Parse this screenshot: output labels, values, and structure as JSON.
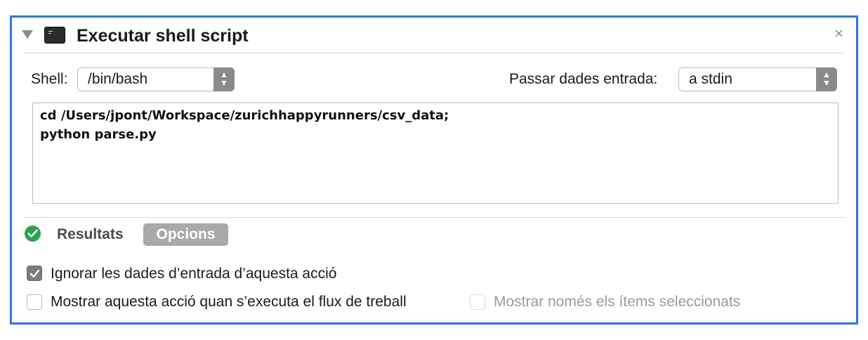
{
  "header": {
    "title": "Executar shell script",
    "close_glyph": "×",
    "icons": [
      "disclosure-triangle-icon",
      "terminal-icon",
      "close-icon"
    ]
  },
  "shell": {
    "label": "Shell:",
    "value": "/bin/bash"
  },
  "input_mode": {
    "label": "Passar dades entrada:",
    "value": "a stdin"
  },
  "script": {
    "lines": [
      "cd /Users/jpont/Workspace/zurichhappyrunners/csv_data;",
      "python parse.py"
    ]
  },
  "tabs": {
    "results_label": "Resultats",
    "options_label": "Opcions",
    "active": "Opcions",
    "status_color": "#2ca14c"
  },
  "options": {
    "ignore_input": {
      "label": "Ignorar les dades d’entrada d’aquesta acció",
      "checked": true
    },
    "show_on_run": {
      "label": "Mostrar aquesta acció quan s’executa el flux de treball",
      "checked": false
    },
    "selected_only": {
      "label": "Mostrar només els ítems seleccionats",
      "checked": false,
      "enabled": false
    }
  },
  "colors": {
    "frame": "#2a78d6",
    "stepper": "#8a8a8a"
  }
}
